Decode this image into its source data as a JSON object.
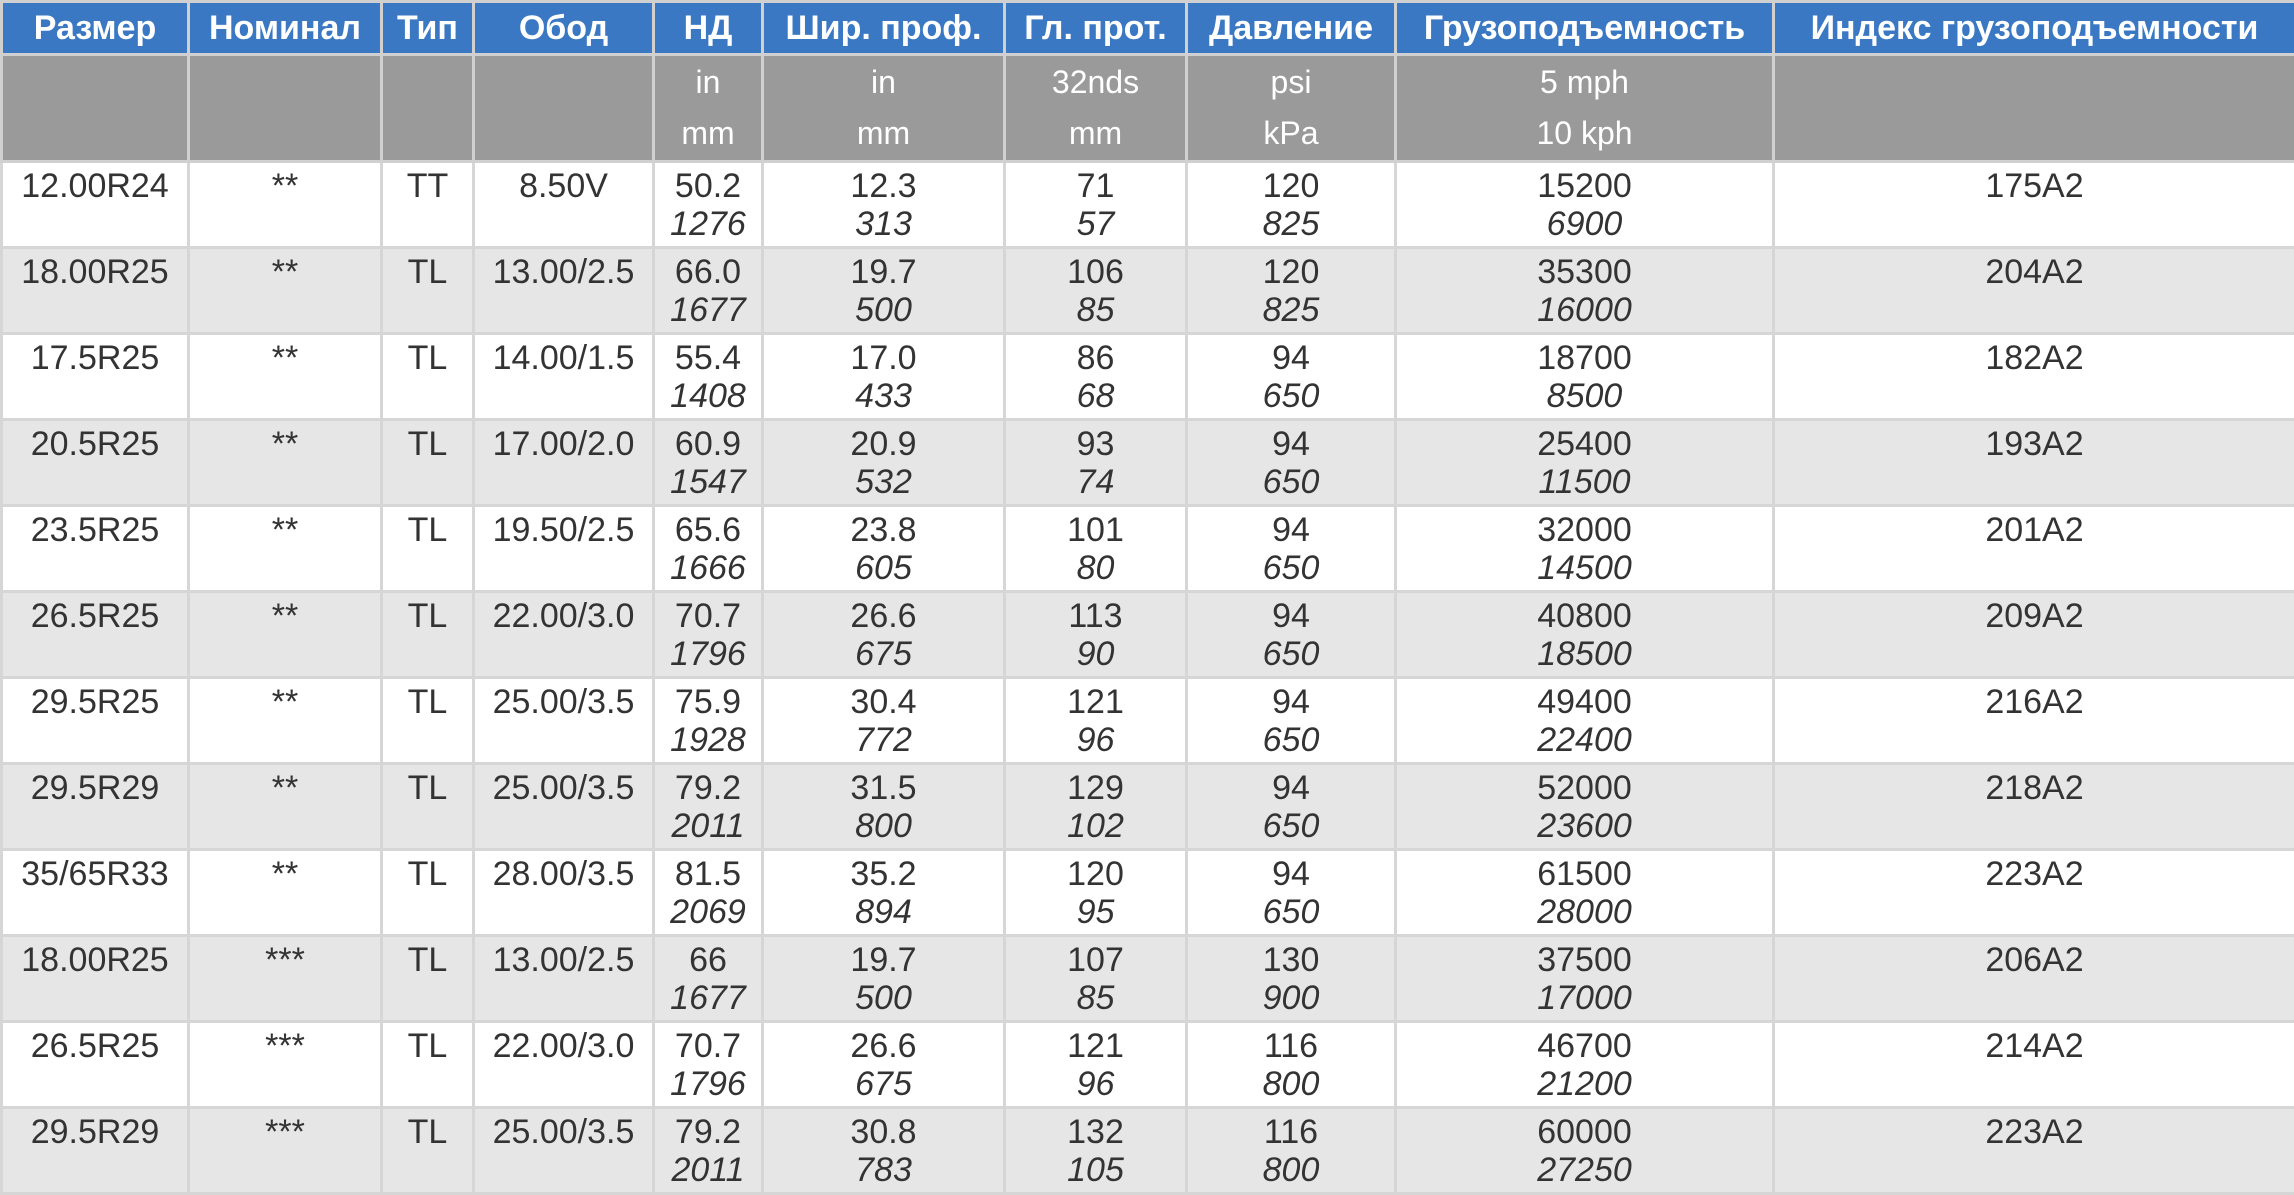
{
  "headers": [
    "Размер",
    "Номинал",
    "Тип",
    "Обод",
    "НД",
    "Шир. проф.",
    "Гл. прот.",
    "Давление",
    "Грузоподъемность",
    "Индекс грузоподъемности"
  ],
  "units": [
    [
      "",
      ""
    ],
    [
      "",
      ""
    ],
    [
      "",
      ""
    ],
    [
      "",
      ""
    ],
    [
      "in",
      "mm"
    ],
    [
      "in",
      "mm"
    ],
    [
      "32nds",
      "mm"
    ],
    [
      "psi",
      "kPa"
    ],
    [
      "5 mph",
      "10 kph"
    ],
    [
      "",
      ""
    ]
  ],
  "rows": [
    {
      "size": "12.00R24",
      "rating": "**",
      "type": "TT",
      "rim": "8.50V",
      "od": [
        "50.2",
        "1276"
      ],
      "width": [
        "12.3",
        "313"
      ],
      "tread": [
        "71",
        "57"
      ],
      "pressure": [
        "120",
        "825"
      ],
      "load": [
        "15200",
        "6900"
      ],
      "index": "175A2"
    },
    {
      "size": "18.00R25",
      "rating": "**",
      "type": "TL",
      "rim": "13.00/2.5",
      "od": [
        "66.0",
        "1677"
      ],
      "width": [
        "19.7",
        "500"
      ],
      "tread": [
        "106",
        "85"
      ],
      "pressure": [
        "120",
        "825"
      ],
      "load": [
        "35300",
        "16000"
      ],
      "index": "204A2"
    },
    {
      "size": "17.5R25",
      "rating": "**",
      "type": "TL",
      "rim": "14.00/1.5",
      "od": [
        "55.4",
        "1408"
      ],
      "width": [
        "17.0",
        "433"
      ],
      "tread": [
        "86",
        "68"
      ],
      "pressure": [
        "94",
        "650"
      ],
      "load": [
        "18700",
        "8500"
      ],
      "index": "182A2"
    },
    {
      "size": "20.5R25",
      "rating": "**",
      "type": "TL",
      "rim": "17.00/2.0",
      "od": [
        "60.9",
        "1547"
      ],
      "width": [
        "20.9",
        "532"
      ],
      "tread": [
        "93",
        "74"
      ],
      "pressure": [
        "94",
        "650"
      ],
      "load": [
        "25400",
        "11500"
      ],
      "index": "193A2"
    },
    {
      "size": "23.5R25",
      "rating": "**",
      "type": "TL",
      "rim": "19.50/2.5",
      "od": [
        "65.6",
        "1666"
      ],
      "width": [
        "23.8",
        "605"
      ],
      "tread": [
        "101",
        "80"
      ],
      "pressure": [
        "94",
        "650"
      ],
      "load": [
        "32000",
        "14500"
      ],
      "index": "201A2"
    },
    {
      "size": "26.5R25",
      "rating": "**",
      "type": "TL",
      "rim": "22.00/3.0",
      "od": [
        "70.7",
        "1796"
      ],
      "width": [
        "26.6",
        "675"
      ],
      "tread": [
        "113",
        "90"
      ],
      "pressure": [
        "94",
        "650"
      ],
      "load": [
        "40800",
        "18500"
      ],
      "index": "209A2"
    },
    {
      "size": "29.5R25",
      "rating": "**",
      "type": "TL",
      "rim": "25.00/3.5",
      "od": [
        "75.9",
        "1928"
      ],
      "width": [
        "30.4",
        "772"
      ],
      "tread": [
        "121",
        "96"
      ],
      "pressure": [
        "94",
        "650"
      ],
      "load": [
        "49400",
        "22400"
      ],
      "index": "216A2"
    },
    {
      "size": "29.5R29",
      "rating": "**",
      "type": "TL",
      "rim": "25.00/3.5",
      "od": [
        "79.2",
        "2011"
      ],
      "width": [
        "31.5",
        "800"
      ],
      "tread": [
        "129",
        "102"
      ],
      "pressure": [
        "94",
        "650"
      ],
      "load": [
        "52000",
        "23600"
      ],
      "index": "218A2"
    },
    {
      "size": "35/65R33",
      "rating": "**",
      "type": "TL",
      "rim": "28.00/3.5",
      "od": [
        "81.5",
        "2069"
      ],
      "width": [
        "35.2",
        "894"
      ],
      "tread": [
        "120",
        "95"
      ],
      "pressure": [
        "94",
        "650"
      ],
      "load": [
        "61500",
        "28000"
      ],
      "index": "223A2"
    },
    {
      "size": "18.00R25",
      "rating": "***",
      "type": "TL",
      "rim": "13.00/2.5",
      "od": [
        "66",
        "1677"
      ],
      "width": [
        "19.7",
        "500"
      ],
      "tread": [
        "107",
        "85"
      ],
      "pressure": [
        "130",
        "900"
      ],
      "load": [
        "37500",
        "17000"
      ],
      "index": "206A2"
    },
    {
      "size": "26.5R25",
      "rating": "***",
      "type": "TL",
      "rim": "22.00/3.0",
      "od": [
        "70.7",
        "1796"
      ],
      "width": [
        "26.6",
        "675"
      ],
      "tread": [
        "121",
        "96"
      ],
      "pressure": [
        "116",
        "800"
      ],
      "load": [
        "46700",
        "21200"
      ],
      "index": "214A2"
    },
    {
      "size": "29.5R29",
      "rating": "***",
      "type": "TL",
      "rim": "25.00/3.5",
      "od": [
        "79.2",
        "2011"
      ],
      "width": [
        "30.8",
        "783"
      ],
      "tread": [
        "132",
        "105"
      ],
      "pressure": [
        "116",
        "800"
      ],
      "load": [
        "60000",
        "27250"
      ],
      "index": "223A2"
    }
  ]
}
